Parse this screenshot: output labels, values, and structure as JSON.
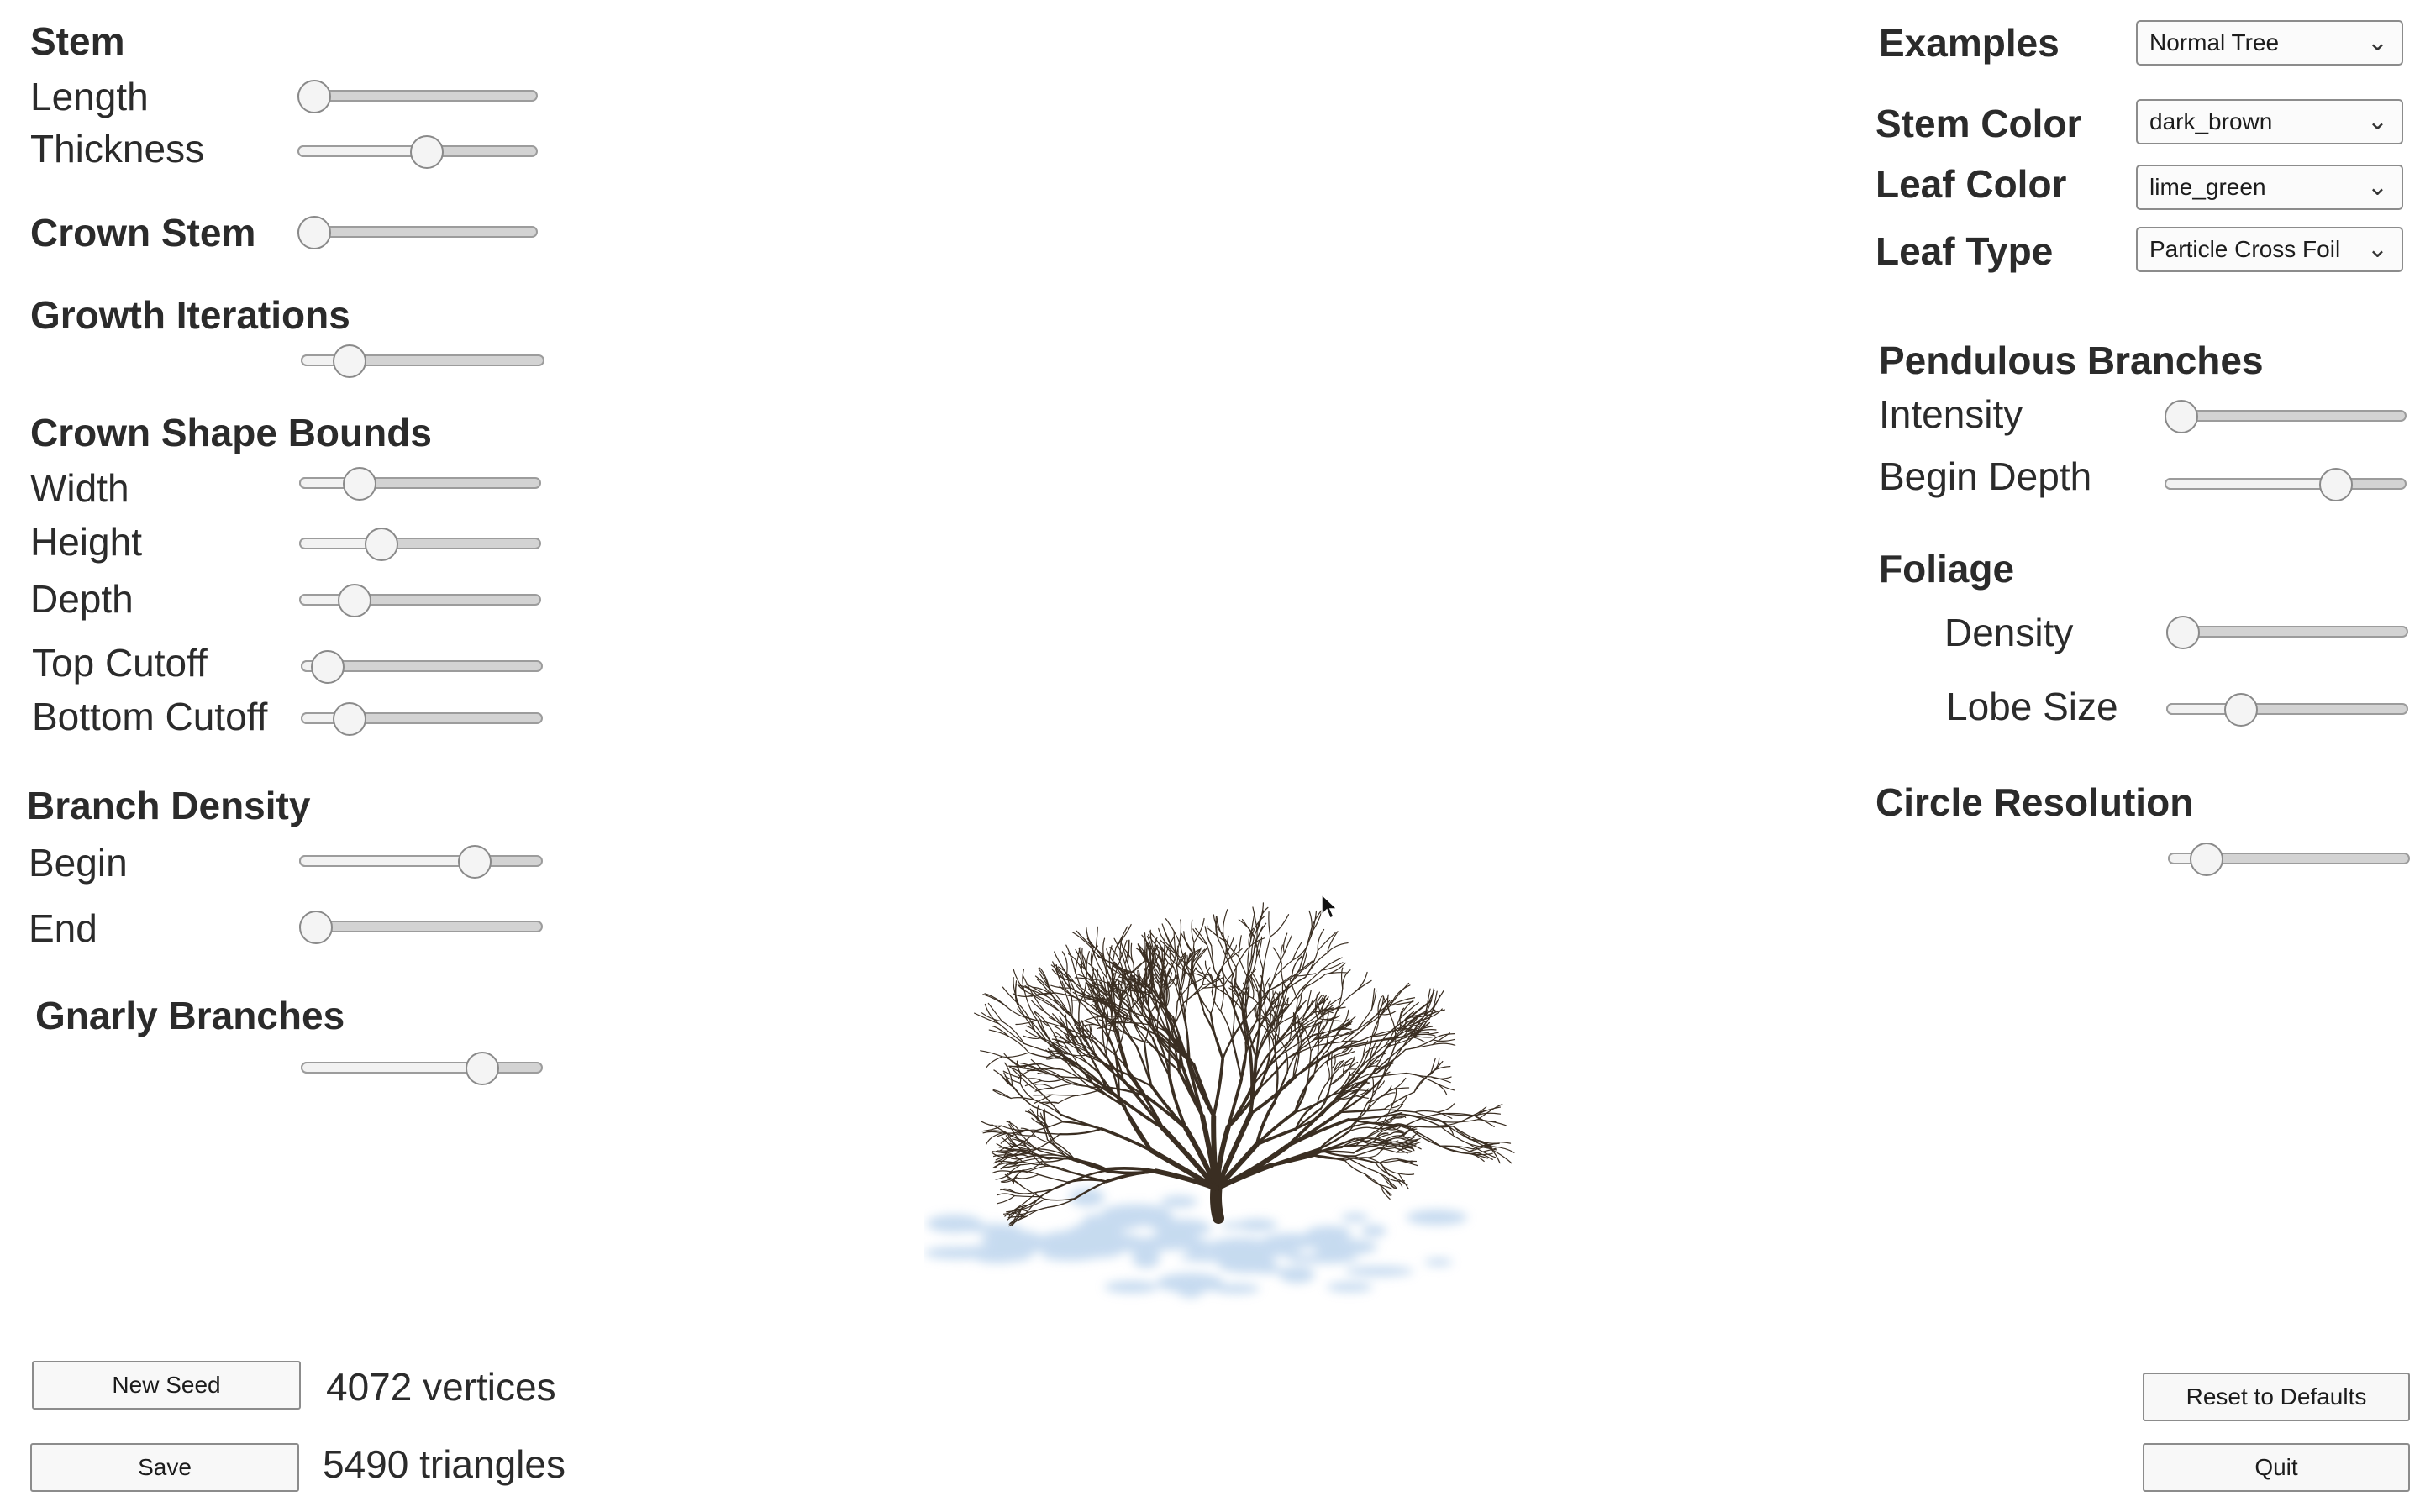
{
  "left_panel": {
    "stem": {
      "heading": "Stem",
      "length_label": "Length",
      "length_value": 0.07,
      "thickness_label": "Thickness",
      "thickness_value": 0.54
    },
    "crown_stem": {
      "heading": "Crown Stem",
      "value": 0.07
    },
    "growth_iterations": {
      "heading": "Growth Iterations",
      "value": 0.2
    },
    "crown_shape": {
      "heading": "Crown Shape Bounds",
      "width_label": "Width",
      "width_value": 0.25,
      "height_label": "Height",
      "height_value": 0.34,
      "depth_label": "Depth",
      "depth_value": 0.23,
      "top_cutoff_label": "Top Cutoff",
      "top_cutoff_value": 0.11,
      "bottom_cutoff_label": "Bottom Cutoff",
      "bottom_cutoff_value": 0.2
    },
    "branch_density": {
      "heading": "Branch Density",
      "begin_label": "Begin",
      "begin_value": 0.72,
      "end_label": "End",
      "end_value": 0.07
    },
    "gnarly": {
      "heading": "Gnarly Branches",
      "value": 0.75
    }
  },
  "right_panel": {
    "examples": {
      "label": "Examples",
      "selected": "Normal Tree"
    },
    "stem_color": {
      "label": "Stem Color",
      "selected": "dark_brown"
    },
    "leaf_color": {
      "label": "Leaf Color",
      "selected": "lime_green"
    },
    "leaf_type": {
      "label": "Leaf Type",
      "selected": "Particle Cross Foil"
    },
    "pendulous": {
      "heading": "Pendulous Branches",
      "intensity_label": "Intensity",
      "intensity_value": 0.07,
      "begin_depth_label": "Begin Depth",
      "begin_depth_value": 0.71
    },
    "foliage": {
      "heading": "Foliage",
      "density_label": "Density",
      "density_value": 0.07,
      "lobe_size_label": "Lobe Size",
      "lobe_size_value": 0.31
    },
    "circle_resolution": {
      "heading": "Circle Resolution",
      "value": 0.16
    }
  },
  "bottom": {
    "new_seed_label": "New Seed",
    "save_label": "Save",
    "vertices_text": "4072 vertices",
    "triangles_text": "5490 triangles",
    "reset_label": "Reset to Defaults",
    "quit_label": "Quit"
  },
  "colors": {
    "stem": "#3a2e22",
    "shadow": "#a9c8e8"
  }
}
